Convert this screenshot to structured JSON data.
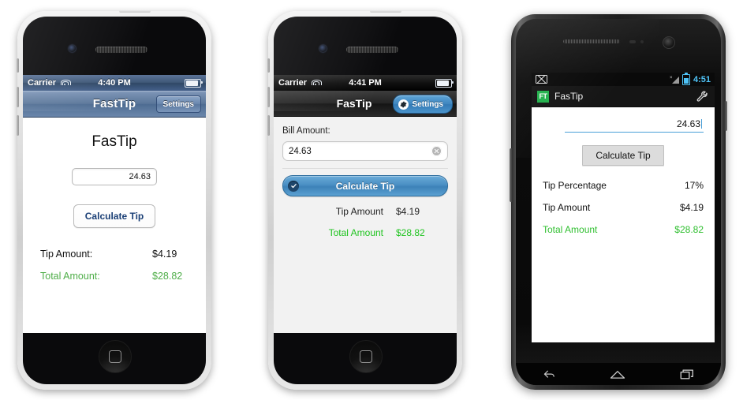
{
  "phones": [
    {
      "id": "iphone-classic",
      "platform": "ios",
      "status": {
        "carrier": "Carrier",
        "time": "4:40 PM",
        "wifi_icon": "wifi-icon",
        "battery_icon": "battery-icon"
      },
      "navbar": {
        "title": "FastTip",
        "settings_label": "Settings"
      },
      "content": {
        "app_title": "FasTip",
        "bill_amount_value": "24.63",
        "calculate_label": "Calculate Tip",
        "rows": [
          {
            "label": "Tip Amount:",
            "value": "$4.19",
            "accent": false
          },
          {
            "label": "Total Amount:",
            "value": "$28.82",
            "accent": true
          }
        ]
      }
    },
    {
      "id": "iphone-dark",
      "platform": "ios",
      "status": {
        "carrier": "Carrier",
        "time": "4:41 PM",
        "wifi_icon": "wifi-icon",
        "battery_icon": "battery-icon"
      },
      "navbar": {
        "title": "FasTip",
        "settings_label": "Settings",
        "settings_icon": "gear-icon"
      },
      "content": {
        "bill_label": "Bill Amount:",
        "bill_amount_value": "24.63",
        "clear_icon": "clear-circle-icon",
        "calculate_label": "Calculate Tip",
        "calculate_icon": "check-circle-icon",
        "rows": [
          {
            "label": "Tip Amount",
            "value": "$4.19",
            "accent": false
          },
          {
            "label": "Total Amount",
            "value": "$28.82",
            "accent": true
          }
        ]
      }
    },
    {
      "id": "android",
      "platform": "android",
      "status": {
        "mail_icon": "mail-icon",
        "signal_icon": "signal-icon",
        "battery_icon": "battery-icon",
        "time": "4:51"
      },
      "actionbar": {
        "logo_text": "FT",
        "title": "FasTip",
        "overflow_icon": "wrench-icon"
      },
      "content": {
        "bill_amount_value": "24.63",
        "calculate_label": "Calculate Tip",
        "rows": [
          {
            "label": "Tip Percentage",
            "value": "17%",
            "accent": false
          },
          {
            "label": "Tip Amount",
            "value": "$4.19",
            "accent": false
          },
          {
            "label": "Total Amount",
            "value": "$28.82",
            "accent": true
          }
        ]
      },
      "navbar": {
        "back_icon": "back-icon",
        "home_icon": "home-icon",
        "recents_icon": "recents-icon"
      }
    }
  ],
  "colors": {
    "accent_green_ios1": "#4fae49",
    "accent_green_ios2": "#21c421",
    "accent_green_android": "#2fbf2f",
    "ios_button_blue": "#1a3f76",
    "android_logo_green": "#22b14c",
    "android_status_blue": "#4fc3f7"
  }
}
